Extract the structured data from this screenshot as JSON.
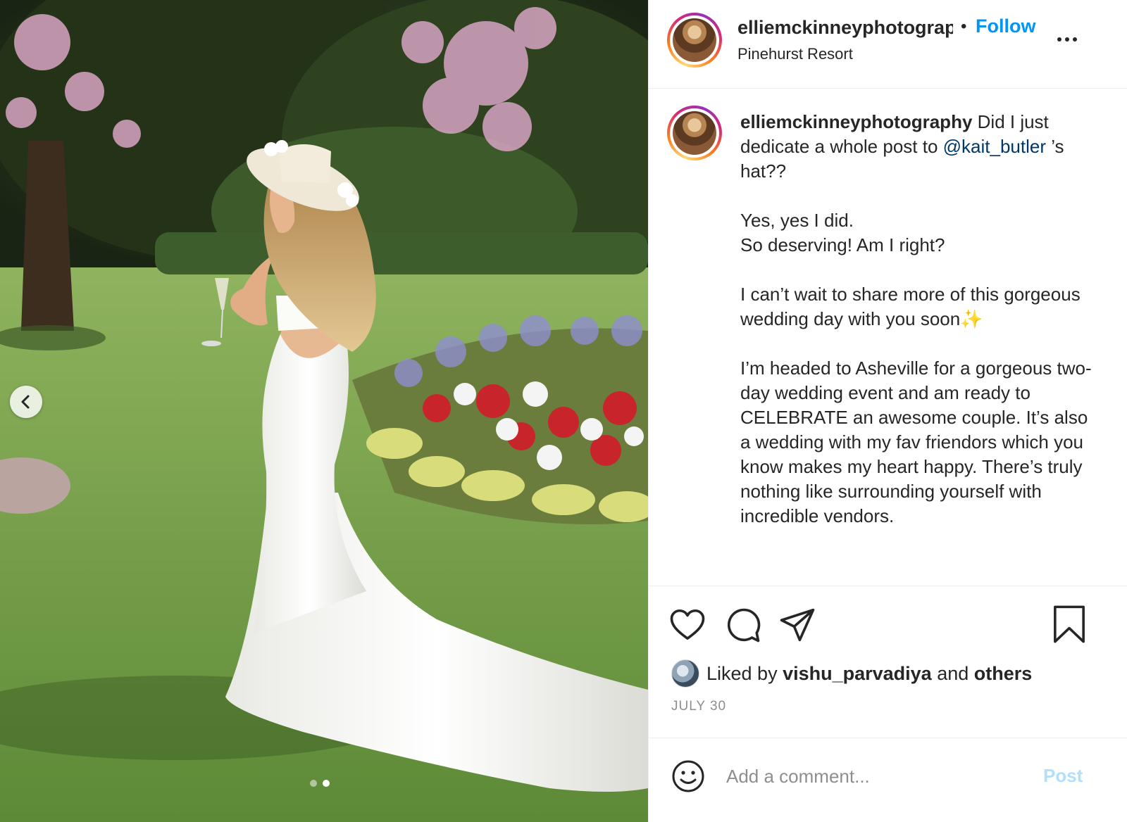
{
  "post": {
    "username": "elliemckinneyphotography",
    "header_username": "elliemckinneyphotograp",
    "dot": "•",
    "follow_label": "Follow",
    "location": "Pinehurst Resort",
    "more_icon": "more-horizontal-icon"
  },
  "caption": {
    "username": "elliemckinneyphotography",
    "line1_before": "Did I just dedicate a whole post to ",
    "mention": "@kait_butler",
    "line1_after": " ’s hat??",
    "p2a": "Yes, yes I did.",
    "p2b": "So deserving! Am I right?",
    "p3": "I can’t wait to share more of this gorgeous wedding day with you soon✨",
    "p4": "I’m headed to Asheville for a gorgeous two-day wedding event and am ready to CELEBRATE an awesome couple. It’s also a wedding with my fav friendors which you know makes my heart happy. There’s truly nothing like surrounding yourself with incredible vendors."
  },
  "actions": {
    "icons": [
      "heart-icon",
      "comment-icon",
      "share-icon",
      "bookmark-icon"
    ]
  },
  "likes": {
    "prefix": "Liked by ",
    "user": "vishu_parvadiya",
    "middle": " and ",
    "others": "others"
  },
  "date": "JULY 30",
  "comment": {
    "placeholder": "Add a comment...",
    "post_label": "Post"
  },
  "carousel": {
    "total": 2,
    "active": 2
  },
  "colors": {
    "link_blue": "#0095f6",
    "mention_blue": "#00376b",
    "post_disabled": "#b2dffc",
    "muted": "#8e8e8e"
  }
}
